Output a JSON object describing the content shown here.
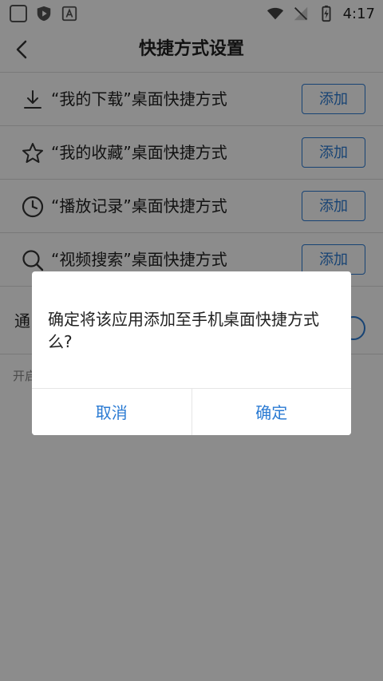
{
  "status_bar": {
    "time": "4:17",
    "icons": [
      "square-icon",
      "play-shield-icon",
      "text-box-icon",
      "wifi-icon",
      "signal-off-icon",
      "battery-charging-icon"
    ]
  },
  "header": {
    "title": "快捷方式设置",
    "back_icon": "chevron-left-icon"
  },
  "shortcuts": [
    {
      "icon": "download-icon",
      "label": "“我的下载”桌面快捷方式",
      "button": "添加"
    },
    {
      "icon": "star-icon",
      "label": "“我的收藏”桌面快捷方式",
      "button": "添加"
    },
    {
      "icon": "clock-icon",
      "label": "“播放记录”桌面快捷方式",
      "button": "添加"
    },
    {
      "icon": "search-icon",
      "label": "“视频搜索”桌面快捷方式",
      "button": "添加"
    }
  ],
  "notify": {
    "label": "通"
  },
  "hint": {
    "text": "开启"
  },
  "dialog": {
    "message": "确定将该应用添加至手机桌面快捷方式么?",
    "cancel": "取消",
    "confirm": "确定"
  },
  "colors": {
    "accent": "#2b7bd3",
    "overlay": "rgba(0,0,0,0.45)"
  }
}
